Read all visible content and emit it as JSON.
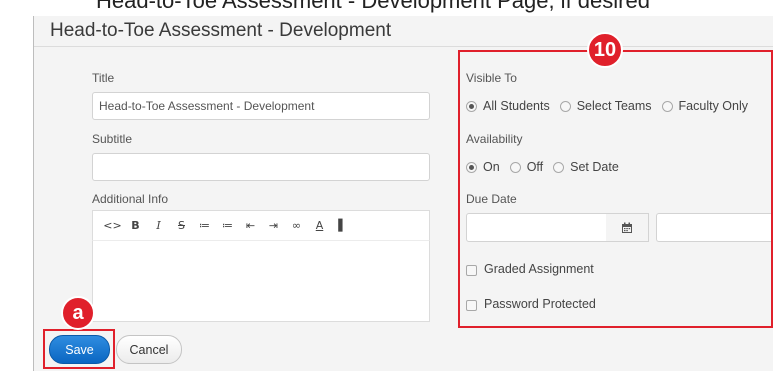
{
  "caption": {
    "text": "Head-to-Toe Assessment - Development Page, if desired"
  },
  "page": {
    "title": "Head-to-Toe Assessment - Development"
  },
  "form": {
    "title_label": "Title",
    "title_value": "Head-to-Toe Assessment - Development",
    "subtitle_label": "Subtitle",
    "subtitle_value": "",
    "additional_info_label": "Additional Info",
    "toolbar": [
      {
        "name": "code-view-icon",
        "glyph": "<>"
      },
      {
        "name": "bold-icon",
        "glyph": "B"
      },
      {
        "name": "italic-icon",
        "glyph": "I"
      },
      {
        "name": "strikethrough-icon",
        "glyph": "S"
      },
      {
        "name": "bulleted-list-icon",
        "glyph": "≔"
      },
      {
        "name": "numbered-list-icon",
        "glyph": "≔"
      },
      {
        "name": "outdent-icon",
        "glyph": "⇤"
      },
      {
        "name": "indent-icon",
        "glyph": "⇥"
      },
      {
        "name": "link-icon",
        "glyph": "∞"
      },
      {
        "name": "font-color-icon",
        "glyph": "A"
      },
      {
        "name": "background-color-icon",
        "glyph": "▌"
      }
    ]
  },
  "settings": {
    "visible_to_label": "Visible To",
    "visible_to_options": [
      {
        "label": "All Students",
        "checked": true
      },
      {
        "label": "Select Teams",
        "checked": false
      },
      {
        "label": "Faculty Only",
        "checked": false
      }
    ],
    "availability_label": "Availability",
    "availability_options": [
      {
        "label": "On",
        "checked": true
      },
      {
        "label": "Off",
        "checked": false
      },
      {
        "label": "Set Date",
        "checked": false
      }
    ],
    "due_date_label": "Due Date",
    "due_date_value": "",
    "due_time_value": "",
    "graded_label": "Graded Assignment",
    "password_label": "Password Protected"
  },
  "callouts": {
    "settings_badge": "10",
    "save_badge": "a",
    "color": "#e0202b"
  },
  "actions": {
    "save_label": "Save",
    "cancel_label": "Cancel"
  }
}
